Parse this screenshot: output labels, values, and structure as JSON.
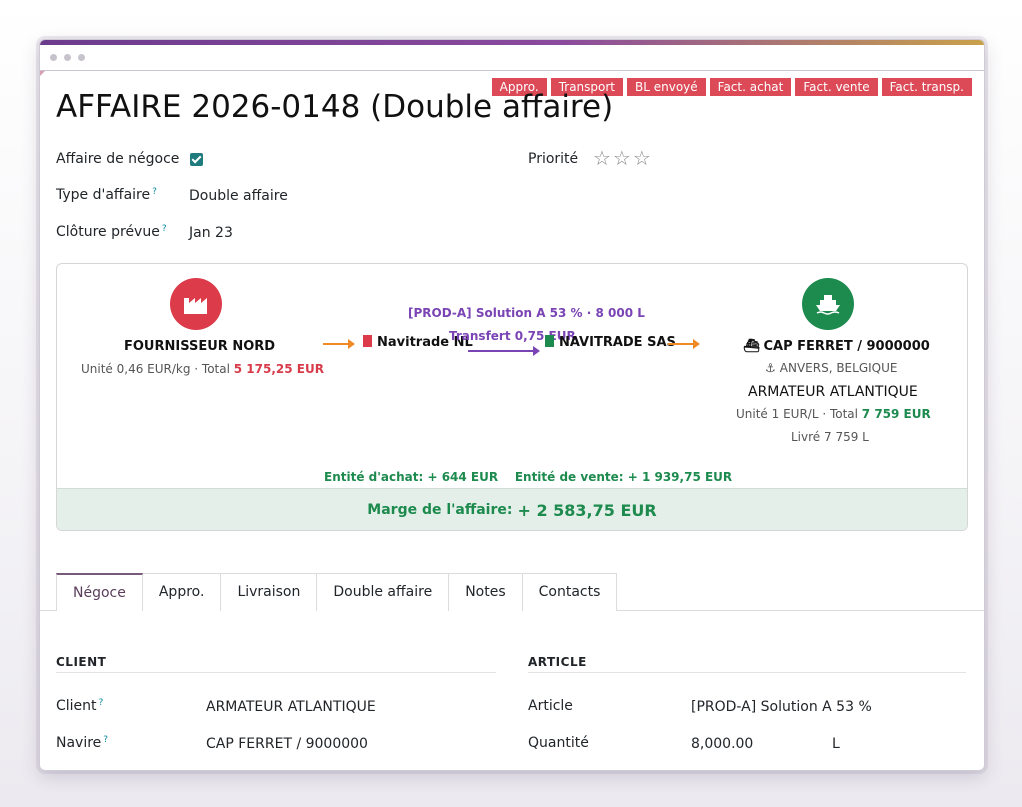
{
  "status_stages": [
    "Appro.",
    "Transport",
    "BL envoyé",
    "Fact. achat",
    "Fact. vente",
    "Fact. transp."
  ],
  "title": "AFFAIRE 2026-0148 (Double affaire)",
  "fields": {
    "negoce_label": "Affaire de négoce",
    "type_label": "Type d'affaire",
    "type_value": "Double affaire",
    "cloture_label": "Clôture prévue",
    "cloture_value": "Jan 23",
    "priority_label": "Priorité",
    "priority_stars": "☆☆☆",
    "help_mark": "?"
  },
  "flow": {
    "supplier": {
      "name": "FOURNISSEUR NORD",
      "unit_text": "Unité 0,46 EUR/kg · Total ",
      "total": "5 175,25 EUR"
    },
    "entity_buy": "Navitrade NL",
    "entity_sell": "NAVITRADE SAS",
    "product_line": "[PROD-A] Solution A 53 % · 8 000 L",
    "transfer_line": "Transfert 0,75 EUR",
    "customer": {
      "vessel": "CAP FERRET / 9000000",
      "port": "ANVERS, BELGIQUE",
      "name": "ARMATEUR ATLANTIQUE",
      "unit_text": "Unité 1 EUR/L · Total ",
      "total": "7 759 EUR",
      "delivered": "Livré 7 759 L"
    },
    "entity_margins": "Entité d'achat: + 644 EUR    Entité de vente: + 1 939,75 EUR",
    "margin_label": "Marge de l'affaire:",
    "margin_value": "+ 2 583,75 EUR",
    "colors": {
      "supplier": "#dc3b4a",
      "customer": "#1d8a4e",
      "purple": "#7a44b5",
      "arrow": "#f08a24"
    }
  },
  "tabs": [
    "Négoce",
    "Appro.",
    "Livraison",
    "Double affaire",
    "Notes",
    "Contacts"
  ],
  "client_section": {
    "title": "CLIENT",
    "client_label": "Client",
    "client_value": "ARMATEUR ATLANTIQUE",
    "navire_label": "Navire",
    "navire_value": "CAP FERRET / 9000000"
  },
  "article_section": {
    "title": "ARTICLE",
    "article_label": "Article",
    "article_value": "[PROD-A] Solution A 53 %",
    "quantite_label": "Quantité",
    "quantite_value": "8,000.00",
    "unit": "L"
  }
}
